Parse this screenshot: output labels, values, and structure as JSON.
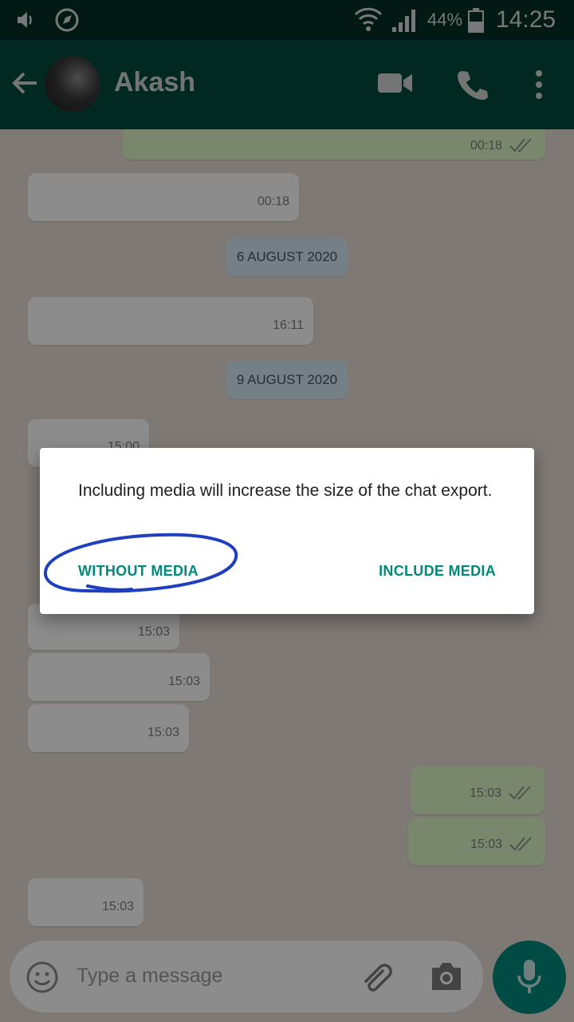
{
  "status_bar": {
    "battery": "44%",
    "time": "14:25"
  },
  "header": {
    "contact_name": "Akash"
  },
  "chat": {
    "messages": [
      {
        "dir": "out",
        "time": "00:18",
        "ticks": true
      },
      {
        "dir": "in",
        "time": "00:18"
      },
      {
        "dir": "date",
        "text": "6 AUGUST 2020"
      },
      {
        "dir": "in",
        "time": "16:11"
      },
      {
        "dir": "date",
        "text": "9 AUGUST 2020"
      },
      {
        "dir": "in",
        "time": "15:00"
      },
      {
        "dir": "in",
        "time": "15:03"
      },
      {
        "dir": "in",
        "time": "15:03"
      },
      {
        "dir": "in",
        "time": "15:03"
      },
      {
        "dir": "out",
        "time": "15:03",
        "ticks": true
      },
      {
        "dir": "out",
        "time": "15:03",
        "ticks": true
      },
      {
        "dir": "in",
        "time": "15:03"
      }
    ]
  },
  "input": {
    "placeholder": "Type a message"
  },
  "dialog": {
    "message": "Including media will increase the size of the chat export.",
    "without_media": "WITHOUT MEDIA",
    "include_media": "INCLUDE MEDIA"
  },
  "colors": {
    "accent": "#00897b",
    "header": "#054c3c",
    "annotation_circle": "#1f3fbf"
  }
}
